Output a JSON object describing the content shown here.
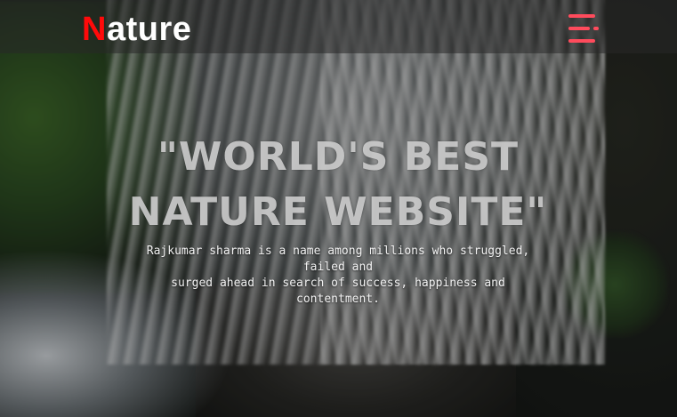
{
  "brand": {
    "first_letter": "N",
    "rest": "ature"
  },
  "menu": {
    "icon": "hamburger-menu-icon"
  },
  "hero": {
    "title_line1": "\"WORLD'S BEST",
    "title_line2": "NATURE WEBSITE\"",
    "text_line1": "Rajkumar sharma is a name among millions who struggled,",
    "text_line2": "failed and",
    "text_line3": "surged ahead in search of success, happiness and",
    "text_line4": "contentment."
  },
  "colors": {
    "brand_accent": "#ff0a0a",
    "menu_accent": "#ff4b5c",
    "header_overlay": "#282828"
  }
}
